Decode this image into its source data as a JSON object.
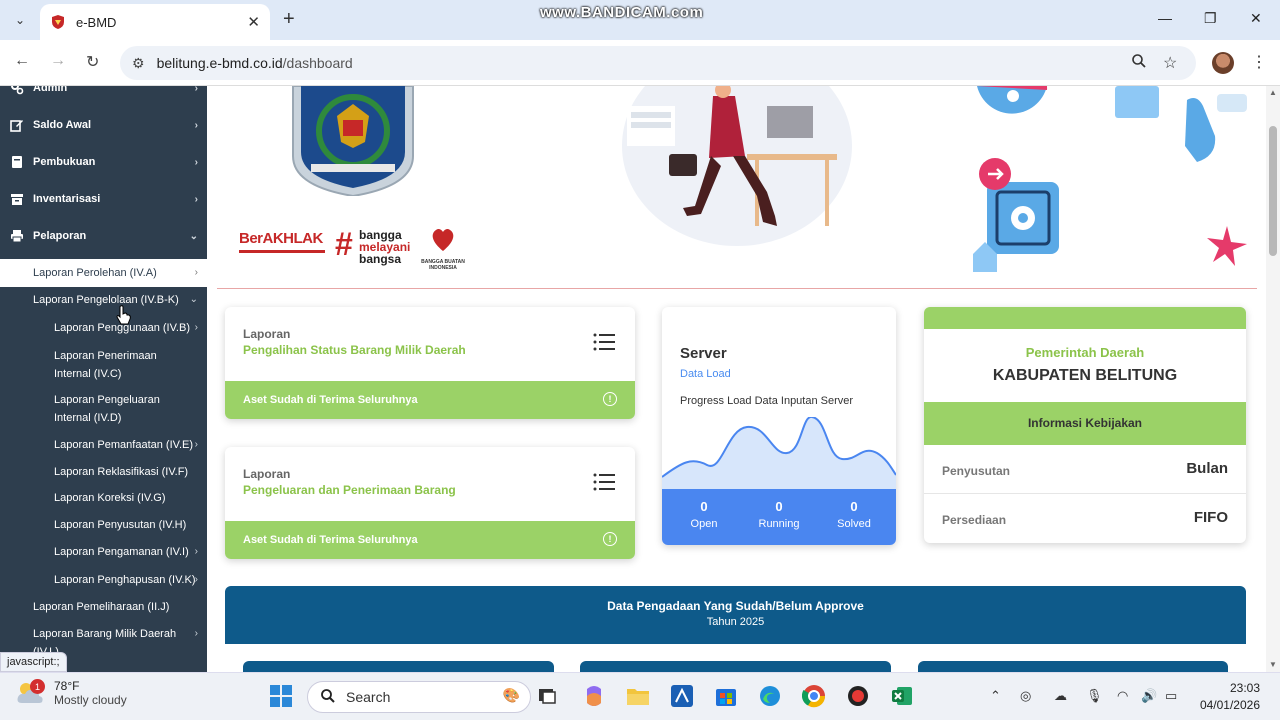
{
  "browser": {
    "tab_title": "e-BMD",
    "watermark": "www.BANDICAM.com",
    "url_host": "belitung.e-bmd.co.id",
    "url_path": "/dashboard"
  },
  "sidebar": {
    "items": [
      {
        "label": "Admin",
        "icon": "gears-icon"
      },
      {
        "label": "Saldo Awal",
        "icon": "edit-icon"
      },
      {
        "label": "Pembukuan",
        "icon": "book-icon"
      },
      {
        "label": "Inventarisasi",
        "icon": "archive-icon"
      },
      {
        "label": "Pelaporan",
        "icon": "print-icon"
      }
    ],
    "subitems": [
      {
        "label": "Laporan Perolehan (IV.A)"
      },
      {
        "label": "Laporan Pengelolaan (IV.B-K)"
      },
      {
        "label": "Laporan Penggunaan (IV.B)"
      },
      {
        "label": "Laporan Penerimaan Internal (IV.C)"
      },
      {
        "label": "Laporan Pengeluaran Internal (IV.D)"
      },
      {
        "label": "Laporan Pemanfaatan (IV.E)"
      },
      {
        "label": "Laporan Reklasifikasi (IV.F)"
      },
      {
        "label": "Laporan Koreksi (IV.G)"
      },
      {
        "label": "Laporan Penyusutan (IV.H)"
      },
      {
        "label": "Laporan Pengamanan (IV.I)"
      },
      {
        "label": "Laporan Penghapusan (IV.K)"
      },
      {
        "label": "Laporan Pemeliharaan (II.J)"
      },
      {
        "label": "Laporan Barang Milik Daerah (IV.L)"
      }
    ],
    "status_tip": "javascript:;"
  },
  "banner": {
    "berakhlak": "BerAKHLAK",
    "bangga": "bangga",
    "melayani": "melayani",
    "bangsa": "bangsa",
    "bbi": "BANGGA BUATAN INDONESIA"
  },
  "cards": {
    "pengalihan": {
      "label": "Laporan",
      "title": "Pengalihan Status Barang Milik Daerah",
      "footer": "Aset Sudah di Terima Seluruhnya"
    },
    "pengeluaran": {
      "label": "Laporan",
      "title": "Pengeluaran dan Penerimaan Barang",
      "footer": "Aset Sudah di Terima Seluruhnya"
    },
    "server": {
      "title": "Server",
      "subtitle": "Data Load",
      "desc": "Progress Load Data Inputan Server",
      "open": "0",
      "open_label": "Open",
      "running": "0",
      "running_label": "Running",
      "solved": "0",
      "solved_label": "Solved"
    },
    "pemda": {
      "org": "Pemerintah Daerah",
      "kab": "KABUPATEN BELITUNG",
      "kebijakan": "Informasi Kebijakan",
      "penyusutan_label": "Penyusutan",
      "penyusutan_value": "Bulan",
      "persediaan_label": "Persediaan",
      "persediaan_value": "FIFO"
    }
  },
  "pengadaan": {
    "title": "Data Pengadaan Yang Sudah/Belum Approve",
    "year": "Tahun 2025"
  },
  "taskbar": {
    "temp": "78°F",
    "condition": "Mostly cloudy",
    "badge": "1",
    "search": "Search",
    "time": "23:03",
    "date": "04/01/2026"
  },
  "colors": {
    "sidebar_bg": "#2e3e4e",
    "green": "#9bd267",
    "server_blue": "#4a86f0",
    "navy": "#0e5a8a"
  }
}
